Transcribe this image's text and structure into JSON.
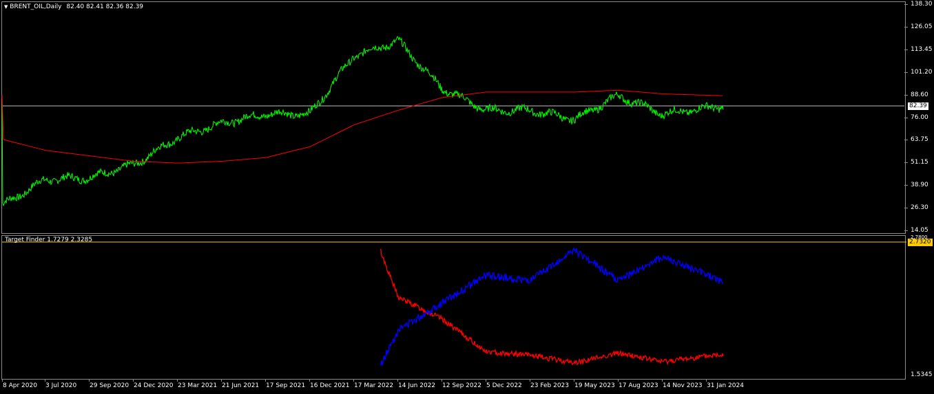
{
  "main_panel": {
    "symbol_header": "BRENT_OIL,Daily",
    "ohlc": "82.40 82.41 82.36 82.39",
    "dropdown_icon": "triangle-down-icon",
    "price_axis": [
      "138.30",
      "126.05",
      "113.45",
      "101.20",
      "88.60",
      "76.00",
      "63.75",
      "51.15",
      "38.90",
      "26.30",
      "14.05"
    ],
    "current_price_label": "82.39",
    "current_price_bg": "#ffffff",
    "line_colors": {
      "price": "#00ff00",
      "ma": "#ff0000",
      "current": "#c0c0c0"
    }
  },
  "indicator_panel": {
    "header": "Target Finder 1.7279 2.3285",
    "axis_top": "2.7320",
    "axis_top_hidden": "2.7800",
    "axis_bottom": "1.5345",
    "level_label": "2.7320",
    "level_color": "#ffcc00",
    "line_colors": {
      "series_a": "#ff0000",
      "series_b": "#0000ff"
    }
  },
  "time_axis": [
    "8 Apr 2020",
    "3 Jul 2020",
    "29 Sep 2020",
    "24 Dec 2020",
    "23 Mar 2021",
    "21 Jun 2021",
    "17 Sep 2021",
    "16 Dec 2021",
    "17 Mar 2022",
    "14 Jun 2022",
    "12 Sep 2022",
    "5 Dec 2022",
    "23 Feb 2023",
    "19 May 2023",
    "17 Aug 2023",
    "14 Nov 2023",
    "31 Jan 2024"
  ],
  "chart_data": [
    {
      "type": "line",
      "title": "BRENT_OIL,Daily",
      "ylim": [
        14.05,
        138.3
      ],
      "x": [
        "8 Apr 2020",
        "3 Jul 2020",
        "29 Sep 2020",
        "24 Dec 2020",
        "23 Mar 2021",
        "21 Jun 2021",
        "17 Sep 2021",
        "16 Dec 2021",
        "17 Mar 2022",
        "14 Jun 2022",
        "12 Sep 2022",
        "5 Dec 2022",
        "23 Feb 2023",
        "19 May 2023",
        "17 Aug 2023",
        "14 Nov 2023",
        "31 Jan 2024"
      ],
      "series": [
        {
          "name": "",
          "values": [
            28,
            42,
            43,
            50,
            65,
            73,
            78,
            78,
            110,
            118,
            92,
            80,
            80,
            75,
            88,
            78,
            82.39
          ]
        },
        {
          "name": "",
          "values": [
            64,
            58,
            55,
            52,
            51,
            52,
            54,
            60,
            72,
            80,
            87,
            90,
            90,
            90,
            91,
            89,
            88
          ]
        }
      ]
    },
    {
      "type": "line",
      "title": "Target Finder 1.7279 2.3285",
      "ylim": [
        1.5345,
        2.78
      ],
      "x": [
        "17 Mar 2022",
        "14 Jun 2022",
        "12 Sep 2022",
        "5 Dec 2022",
        "23 Feb 2023",
        "19 May 2023",
        "17 Aug 2023",
        "14 Nov 2023",
        "31 Jan 2024"
      ],
      "series": [
        {
          "name": "",
          "values": [
            2.68,
            2.25,
            2.05,
            1.75,
            1.72,
            1.65,
            1.74,
            1.66,
            1.73
          ]
        },
        {
          "name": "",
          "values": [
            1.62,
            1.95,
            2.2,
            2.45,
            2.4,
            2.68,
            2.4,
            2.62,
            2.39
          ]
        }
      ]
    }
  ]
}
